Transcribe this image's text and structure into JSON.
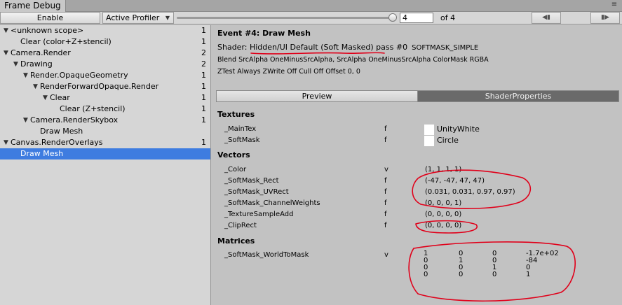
{
  "window": {
    "tab_title": "Frame Debug"
  },
  "toolbar": {
    "enable_label": "Enable",
    "profiler_label": "Active Profiler",
    "event_index": "4",
    "of_label": "of 4",
    "slider_fraction": 1.0
  },
  "tree": [
    {
      "label": "<unknown scope>",
      "count": "1",
      "depth": 0,
      "arrow": true
    },
    {
      "label": "Clear (color+Z+stencil)",
      "count": "1",
      "depth": 1,
      "arrow": false
    },
    {
      "label": "Camera.Render",
      "count": "2",
      "depth": 0,
      "arrow": true
    },
    {
      "label": "Drawing",
      "count": "2",
      "depth": 1,
      "arrow": true
    },
    {
      "label": "Render.OpaqueGeometry",
      "count": "1",
      "depth": 2,
      "arrow": true
    },
    {
      "label": "RenderForwardOpaque.Render",
      "count": "1",
      "depth": 3,
      "arrow": true
    },
    {
      "label": "Clear",
      "count": "1",
      "depth": 4,
      "arrow": true
    },
    {
      "label": "Clear (Z+stencil)",
      "count": "1",
      "depth": 5,
      "arrow": false
    },
    {
      "label": "Camera.RenderSkybox",
      "count": "1",
      "depth": 2,
      "arrow": true
    },
    {
      "label": "Draw Mesh",
      "count": "",
      "depth": 3,
      "arrow": false
    },
    {
      "label": "Canvas.RenderOverlays",
      "count": "1",
      "depth": 0,
      "arrow": true
    },
    {
      "label": "Draw Mesh",
      "count": "",
      "depth": 1,
      "arrow": false,
      "selected": true
    }
  ],
  "details": {
    "event_title": "Event #4: Draw Mesh",
    "shader_prefix": "Shader: ",
    "shader_name": "Hidden/UI Default (Soft Masked)",
    "pass_label": " pass #0",
    "keyword": "SOFTMASK_SIMPLE",
    "blend_line": "Blend SrcAlpha OneMinusSrcAlpha, SrcAlpha OneMinusSrcAlpha ColorMask RGBA",
    "ztest_line": "ZTest Always ZWrite Off Cull Off Offset 0, 0",
    "tab_preview": "Preview",
    "tab_shader_properties": "ShaderProperties"
  },
  "textures": {
    "heading": "Textures",
    "items": [
      {
        "name": "_MainTex",
        "type": "f",
        "value": "UnityWhite"
      },
      {
        "name": "_SoftMask",
        "type": "f",
        "value": "Circle"
      }
    ]
  },
  "vectors": {
    "heading": "Vectors",
    "items": [
      {
        "name": "_Color",
        "type": "v",
        "value": "(1, 1, 1, 1)"
      },
      {
        "name": "_SoftMask_Rect",
        "type": "f",
        "value": "(-47, -47, 47, 47)"
      },
      {
        "name": "_SoftMask_UVRect",
        "type": "f",
        "value": "(0.031, 0.031, 0.97, 0.97)"
      },
      {
        "name": "_SoftMask_ChannelWeights",
        "type": "f",
        "value": "(0, 0, 0, 1)"
      },
      {
        "name": "_TextureSampleAdd",
        "type": "f",
        "value": "(0, 0, 0, 0)"
      },
      {
        "name": "_ClipRect",
        "type": "f",
        "value": "(0, 0, 0, 0)"
      }
    ]
  },
  "matrices": {
    "heading": "Matrices",
    "items": [
      {
        "name": "_SoftMask_WorldToMask",
        "type": "v",
        "rows": [
          [
            "1",
            "0",
            "0",
            "-1.7e+02"
          ],
          [
            "0",
            "1",
            "0",
            "-84"
          ],
          [
            "0",
            "0",
            "1",
            "0"
          ],
          [
            "0",
            "0",
            "0",
            "1"
          ]
        ]
      }
    ]
  },
  "colors": {
    "selection": "#3e7ce0",
    "annotation_ink": "#e0001a",
    "active_tab": "#6a6a6a"
  },
  "icons": {
    "expand_arrow": "triangle-down-icon",
    "dropdown": "chevron-down-icon",
    "prev": "step-back-icon",
    "next": "step-forward-icon",
    "menu": "tab-menu-icon"
  }
}
